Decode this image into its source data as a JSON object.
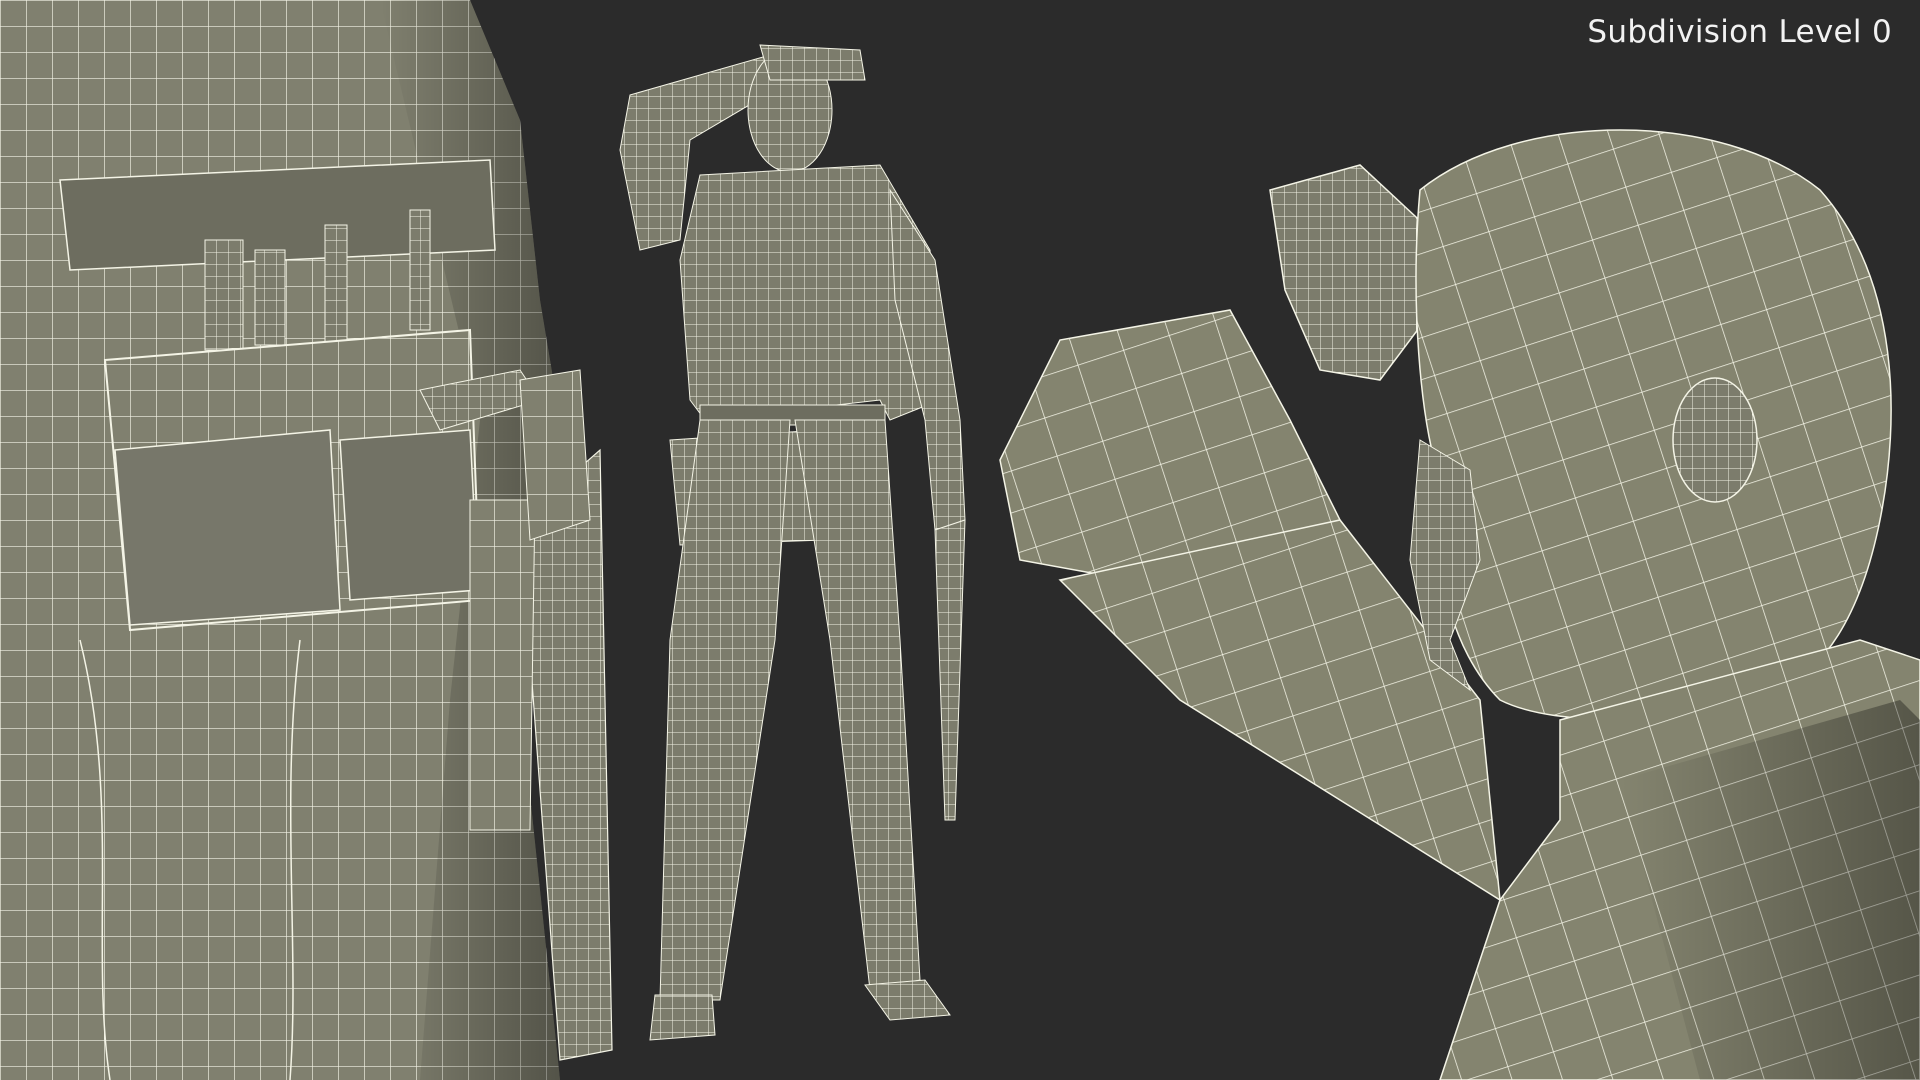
{
  "overlay": {
    "subdivision_label": "Subdivision Level 0"
  },
  "scene": {
    "background_color": "#2b2b2b",
    "mesh_fill_color": "#80806f",
    "mesh_shadow_color": "#5a5a4e",
    "wire_color": "#f4f4e6",
    "panels": [
      {
        "id": "belt-closeup",
        "subject": "tool belt and hand saw close-up"
      },
      {
        "id": "full-body",
        "subject": "worker standing, hand shading eyes, holding saw"
      },
      {
        "id": "head-closeup",
        "subject": "head and arm close-up"
      }
    ]
  }
}
